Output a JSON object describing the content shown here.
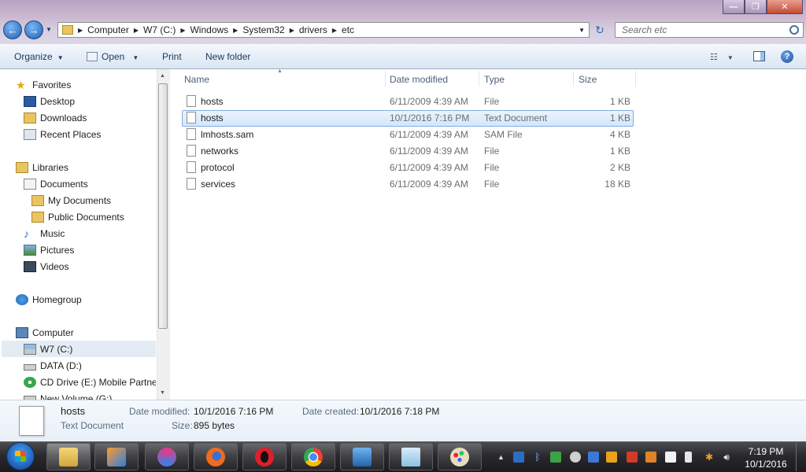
{
  "window": {
    "minimize": "—",
    "maximize": "❐",
    "close": "✕"
  },
  "address": {
    "crumbs": [
      "Computer",
      "W7 (C:)",
      "Windows",
      "System32",
      "drivers",
      "etc"
    ],
    "search_placeholder": "Search etc"
  },
  "toolbar": {
    "organize": "Organize",
    "open": "Open",
    "print": "Print",
    "new_folder": "New folder"
  },
  "nav": {
    "favorites": "Favorites",
    "desktop": "Desktop",
    "downloads": "Downloads",
    "recent": "Recent Places",
    "libraries": "Libraries",
    "documents": "Documents",
    "my_documents": "My Documents",
    "public_documents": "Public Documents",
    "music": "Music",
    "pictures": "Pictures",
    "videos": "Videos",
    "homegroup": "Homegroup",
    "computer": "Computer",
    "c_drive": "W7 (C:)",
    "d_drive": "DATA (D:)",
    "e_drive": "CD Drive (E:) Mobile Partner",
    "g_drive": "New Volume (G:)"
  },
  "columns": {
    "name": "Name",
    "date": "Date modified",
    "type": "Type",
    "size": "Size"
  },
  "files": [
    {
      "name": "hosts",
      "date": "6/11/2009 4:39 AM",
      "type": "File",
      "size": "1 KB"
    },
    {
      "name": "hosts",
      "date": "10/1/2016 7:16 PM",
      "type": "Text Document",
      "size": "1 KB"
    },
    {
      "name": "lmhosts.sam",
      "date": "6/11/2009 4:39 AM",
      "type": "SAM File",
      "size": "4 KB"
    },
    {
      "name": "networks",
      "date": "6/11/2009 4:39 AM",
      "type": "File",
      "size": "1 KB"
    },
    {
      "name": "protocol",
      "date": "6/11/2009 4:39 AM",
      "type": "File",
      "size": "2 KB"
    },
    {
      "name": "services",
      "date": "6/11/2009 4:39 AM",
      "type": "File",
      "size": "18 KB"
    }
  ],
  "details": {
    "name": "hosts",
    "type": "Text Document",
    "modified_label": "Date modified:",
    "modified_value": "10/1/2016 7:16 PM",
    "size_label": "Size:",
    "size_value": "895 bytes",
    "created_label": "Date created:",
    "created_value": "10/1/2016 7:18 PM"
  },
  "clock": {
    "time": "7:19 PM",
    "date": "10/1/2016"
  },
  "colors": {
    "accent": "#1d5fb4",
    "selection": "#d2e7fc",
    "taskbar": "#2a2a2e"
  }
}
